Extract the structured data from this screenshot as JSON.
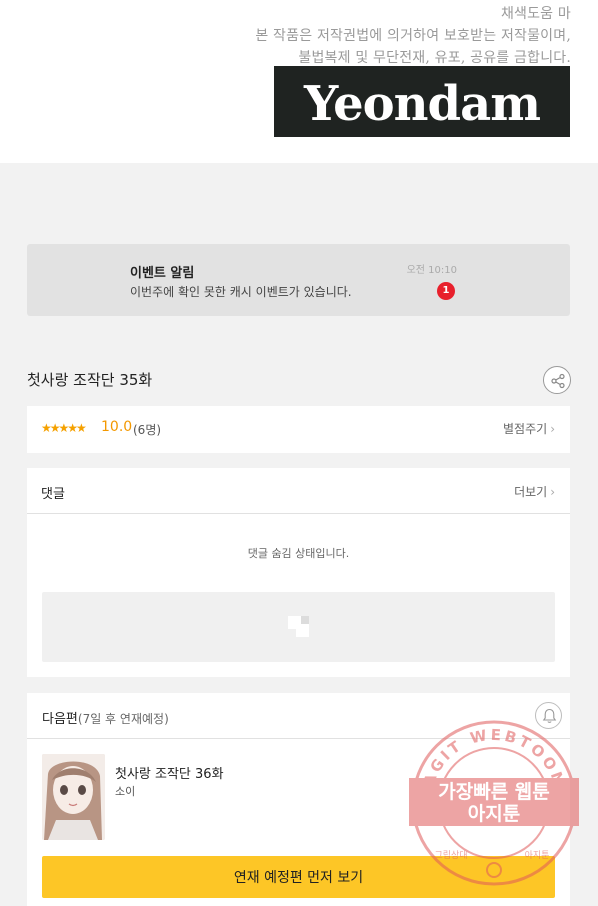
{
  "copyright": {
    "line1": "채색도움 마",
    "line2": "본 작품은 저작권법에 의거하여 보호받는 저작물이며,",
    "line3": "불법복제 및 무단전재, 유포, 공유를 금합니다."
  },
  "logo": {
    "text": "Yeondam"
  },
  "event": {
    "title": "이벤트 알림",
    "desc": "이번주에 확인 못한 캐시 이벤트가 있습니다.",
    "time": "오전 10:10",
    "badge": "1"
  },
  "episode": {
    "title": "첫사랑 조작단 35화"
  },
  "rating": {
    "stars": "★★★★★",
    "score": "10.0",
    "count": "(6명)",
    "rate_label": "별점주기",
    "score_value": 10.0
  },
  "comments": {
    "label": "댓글",
    "more": "더보기",
    "hidden_msg": "댓글 숨김 상태입니다."
  },
  "next": {
    "label": "다음편",
    "sub": "(7일 후 연재예정)",
    "ep_name": "첫사랑 조작단 36화",
    "author": "소이",
    "button": "연재 예정편 먼저 보기"
  },
  "watermark": {
    "arc_text": "AGIT WEBTOON",
    "line1": "가장빠른 웹툰",
    "line2": "아지툰",
    "bottom_left": "그립상대",
    "bottom_right": "아지툰"
  },
  "colors": {
    "accent": "#fdc626",
    "badge": "#e8202c",
    "rating": "#f39800",
    "logo_bg": "#1f2321",
    "stamp": "#e05a5a"
  },
  "icons": {
    "share": "share-icon",
    "chevron": "chevron-right-icon",
    "bell": "bell-icon",
    "ad_placeholder": "image-placeholder-icon"
  }
}
